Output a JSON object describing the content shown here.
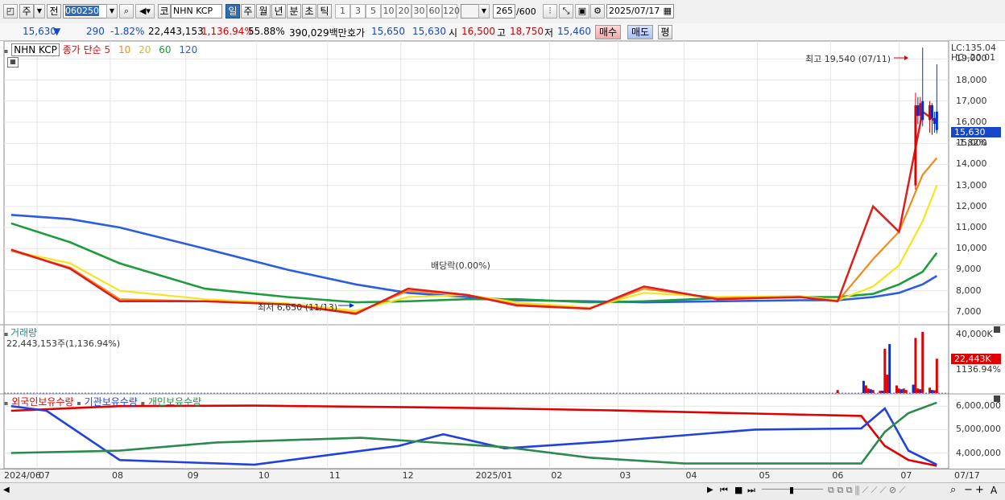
{
  "toolbar": {
    "week_label": "주",
    "prev_label": "전",
    "stock_code": "060250",
    "code_prefix": "코",
    "stock_name": "NHN KCP",
    "periods": [
      "일",
      "주",
      "월",
      "년",
      "분",
      "초",
      "틱"
    ],
    "active_period": "일",
    "numbers": [
      "1",
      "3",
      "5",
      "10",
      "20",
      "30",
      "60",
      "120"
    ],
    "count_value": "265",
    "count_total": "/600",
    "date": "2025/07/17"
  },
  "quote": {
    "price": "15,630",
    "arrow": "▼",
    "change": "290",
    "change_pct": "-1.82%",
    "volume": "22,443,153",
    "volume_ratio": "1,136.94%",
    "turnover": "55.88%",
    "amount": "390,029백만",
    "ask_label": "호가",
    "ask": "15,650",
    "bid": "15,630",
    "open_label": "시",
    "open": "16,500",
    "high_label": "고",
    "high": "18,750",
    "low_label": "저",
    "low": "15,460",
    "buy_label": "매수",
    "sell_label": "매도",
    "avg_label": "평"
  },
  "price_legend": {
    "name": "NHN KCP",
    "ma_label": "종가 단순",
    "ma_periods": [
      "5",
      "10",
      "20",
      "60",
      "120"
    ]
  },
  "price_axis": {
    "ticks": [
      "19,000",
      "18,000",
      "17,000",
      "16,000",
      "15,000",
      "14,000",
      "13,000",
      "12,000",
      "11,000",
      "10,000",
      "9,000",
      "8,000",
      "7,000"
    ],
    "lc": "LC:135.04",
    "hc": "HC:-20.01",
    "current": "15,630",
    "current_pct": "-1.82%"
  },
  "annotations": {
    "high": "최고 19,540 (07/11)",
    "low": "최저 6,650 (11/13)",
    "dividend": "배당락(0.00%)"
  },
  "volume": {
    "title": "거래량",
    "value": "22,443,153주(1,136.94%)",
    "axis_max": "40,000K",
    "current": "22,443K",
    "current_pct": "1136.94%"
  },
  "holdings": {
    "labels": [
      "외국인보유수량",
      "기관보유수량",
      "개인보유수량"
    ],
    "ticks": [
      "6,000,000",
      "5,000,000",
      "4,000,000"
    ]
  },
  "x_axis": {
    "labels": [
      "2024/06",
      "07",
      "08",
      "09",
      "10",
      "11",
      "12",
      "2025/01",
      "02",
      "03",
      "04",
      "05",
      "06",
      "07"
    ],
    "end_date": "07/17"
  },
  "colors": {
    "ma5": "#e01c1c",
    "ma10": "#f08c1e",
    "ma20": "#f5e41e",
    "ma60": "#1e9c3c",
    "ma120": "#2c5ce0",
    "foreign": "#e00000",
    "institution": "#2040e0",
    "individual": "#2c8a4c",
    "up": "#e00000",
    "down": "#0030d0"
  },
  "chart_data": [
    {
      "type": "line",
      "title": "NHN KCP",
      "series": [
        {
          "name": "5",
          "x": [
            "2024-06-20",
            "2024-07-15",
            "2024-08-05",
            "2024-09-10",
            "2024-10-15",
            "2024-11-13",
            "2024-12-05",
            "2024-12-30",
            "2025-01-20",
            "2025-02-20",
            "2025-03-15",
            "2025-04-15",
            "2025-05-20",
            "2025-06-05",
            "2025-06-20",
            "2025-07-01",
            "2025-07-11",
            "2025-07-17"
          ],
          "y": [
            9950,
            9050,
            7500,
            7500,
            7350,
            6900,
            8100,
            7800,
            7300,
            7150,
            8200,
            7600,
            7700,
            7500,
            12000,
            10800,
            16500,
            16000
          ]
        },
        {
          "name": "10",
          "x": [
            "2024-06-20",
            "2024-07-15",
            "2024-08-05",
            "2024-09-10",
            "2024-10-15",
            "2024-11-13",
            "2024-12-05",
            "2024-12-30",
            "2025-01-20",
            "2025-02-20",
            "2025-03-15",
            "2025-04-15",
            "2025-05-20",
            "2025-06-05",
            "2025-06-20",
            "2025-07-01",
            "2025-07-11",
            "2025-07-17"
          ],
          "y": [
            9900,
            9100,
            7600,
            7500,
            7350,
            6950,
            8000,
            7800,
            7350,
            7150,
            8100,
            7650,
            7700,
            7500,
            9500,
            10800,
            13500,
            14300
          ]
        },
        {
          "name": "20",
          "x": [
            "2024-06-20",
            "2024-07-15",
            "2024-08-05",
            "2024-09-10",
            "2024-10-15",
            "2024-11-13",
            "2024-12-05",
            "2024-12-30",
            "2025-01-20",
            "2025-02-20",
            "2025-03-15",
            "2025-04-15",
            "2025-05-20",
            "2025-06-05",
            "2025-06-20",
            "2025-07-01",
            "2025-07-11",
            "2025-07-17"
          ],
          "y": [
            9900,
            9300,
            8000,
            7600,
            7400,
            7050,
            7700,
            7800,
            7450,
            7200,
            7900,
            7700,
            7750,
            7550,
            8200,
            9200,
            11300,
            13000
          ]
        },
        {
          "name": "60",
          "x": [
            "2024-06-20",
            "2024-07-15",
            "2024-08-05",
            "2024-09-10",
            "2024-10-15",
            "2024-11-13",
            "2024-12-05",
            "2024-12-30",
            "2025-01-20",
            "2025-02-20",
            "2025-03-15",
            "2025-04-15",
            "2025-05-20",
            "2025-06-05",
            "2025-06-20",
            "2025-07-01",
            "2025-07-11",
            "2025-07-17"
          ],
          "y": [
            11200,
            10300,
            9300,
            8100,
            7700,
            7450,
            7500,
            7600,
            7600,
            7450,
            7500,
            7650,
            7700,
            7700,
            7850,
            8300,
            8900,
            9800
          ]
        },
        {
          "name": "120",
          "x": [
            "2024-06-20",
            "2024-07-15",
            "2024-08-05",
            "2024-09-10",
            "2024-10-15",
            "2024-11-13",
            "2024-12-05",
            "2024-12-30",
            "2025-01-20",
            "2025-02-20",
            "2025-03-15",
            "2025-04-15",
            "2025-05-20",
            "2025-06-05",
            "2025-06-20",
            "2025-07-01",
            "2025-07-11",
            "2025-07-17"
          ],
          "y": [
            11600,
            11400,
            11000,
            10000,
            9000,
            8300,
            7900,
            7700,
            7550,
            7500,
            7450,
            7500,
            7550,
            7550,
            7700,
            7900,
            8300,
            8700
          ]
        }
      ],
      "candles": [
        {
          "x": "2025-07-08",
          "open": 13000,
          "close": 16800,
          "high": 17400,
          "low": 12800
        },
        {
          "x": "2025-07-09",
          "open": 16800,
          "close": 16300,
          "high": 17200,
          "low": 15900
        },
        {
          "x": "2025-07-10",
          "open": 16300,
          "close": 16900,
          "high": 17200,
          "low": 16000
        },
        {
          "x": "2025-07-11",
          "open": 17000,
          "close": 16100,
          "high": 19540,
          "low": 15800
        },
        {
          "x": "2025-07-14",
          "open": 16100,
          "close": 16800,
          "high": 17000,
          "low": 15500
        },
        {
          "x": "2025-07-15",
          "open": 16800,
          "close": 16200,
          "high": 16900,
          "low": 15400
        },
        {
          "x": "2025-07-16",
          "open": 16200,
          "close": 15920,
          "high": 16500,
          "low": 15500
        },
        {
          "x": "2025-07-17",
          "open": 16500,
          "close": 15630,
          "high": 18750,
          "low": 15460
        }
      ],
      "ylim": [
        6500,
        19700
      ]
    },
    {
      "type": "bar",
      "title": "거래량",
      "x": [
        "2025-06-05",
        "2025-06-16",
        "2025-06-17",
        "2025-06-18",
        "2025-06-19",
        "2025-06-20",
        "2025-06-23",
        "2025-06-24",
        "2025-06-25",
        "2025-06-26",
        "2025-06-27",
        "2025-06-30",
        "2025-07-01",
        "2025-07-02",
        "2025-07-03",
        "2025-07-04",
        "2025-07-07",
        "2025-07-08",
        "2025-07-09",
        "2025-07-10",
        "2025-07-11",
        "2025-07-14",
        "2025-07-15",
        "2025-07-16",
        "2025-07-17"
      ],
      "values": [
        2000,
        8000,
        5000,
        3000,
        2500,
        2000,
        1500,
        1500,
        29000,
        12000,
        32000,
        5000,
        3000,
        2500,
        3000,
        2000,
        5500,
        36000,
        3000,
        2500,
        40000,
        3500,
        2000,
        1800,
        22443
      ],
      "ylabel": "K",
      "ylim": [
        0,
        42000
      ]
    },
    {
      "type": "line",
      "series": [
        {
          "name": "외국인보유수량",
          "x": [
            "2024-06-20",
            "2024-08-05",
            "2024-10-01",
            "2024-12-01",
            "2025-01-15",
            "2025-03-01",
            "2025-05-01",
            "2025-06-15",
            "2025-06-25",
            "2025-07-05",
            "2025-07-17"
          ],
          "y": [
            5800000,
            6000000,
            6020000,
            5960000,
            5900000,
            5820000,
            5680000,
            5580000,
            4300000,
            3700000,
            3450000
          ]
        },
        {
          "name": "기관보유수량",
          "x": [
            "2024-06-20",
            "2024-07-05",
            "2024-08-05",
            "2024-10-01",
            "2024-12-01",
            "2024-12-20",
            "2025-01-15",
            "2025-03-01",
            "2025-05-01",
            "2025-06-15",
            "2025-06-25",
            "2025-07-05",
            "2025-07-17"
          ],
          "y": [
            6000000,
            5800000,
            3700000,
            3500000,
            4300000,
            4800000,
            4200000,
            4500000,
            5000000,
            5050000,
            5900000,
            4100000,
            3500000
          ]
        },
        {
          "name": "개인보유수량",
          "x": [
            "2024-06-20",
            "2024-08-05",
            "2024-09-15",
            "2024-11-15",
            "2025-01-15",
            "2025-02-20",
            "2025-04-01",
            "2025-06-15",
            "2025-06-25",
            "2025-07-05",
            "2025-07-17"
          ],
          "y": [
            4000000,
            4100000,
            4450000,
            4650000,
            4250000,
            3800000,
            3550000,
            3550000,
            4900000,
            5700000,
            6150000
          ]
        }
      ],
      "ylim": [
        3400000,
        6350000
      ]
    }
  ]
}
